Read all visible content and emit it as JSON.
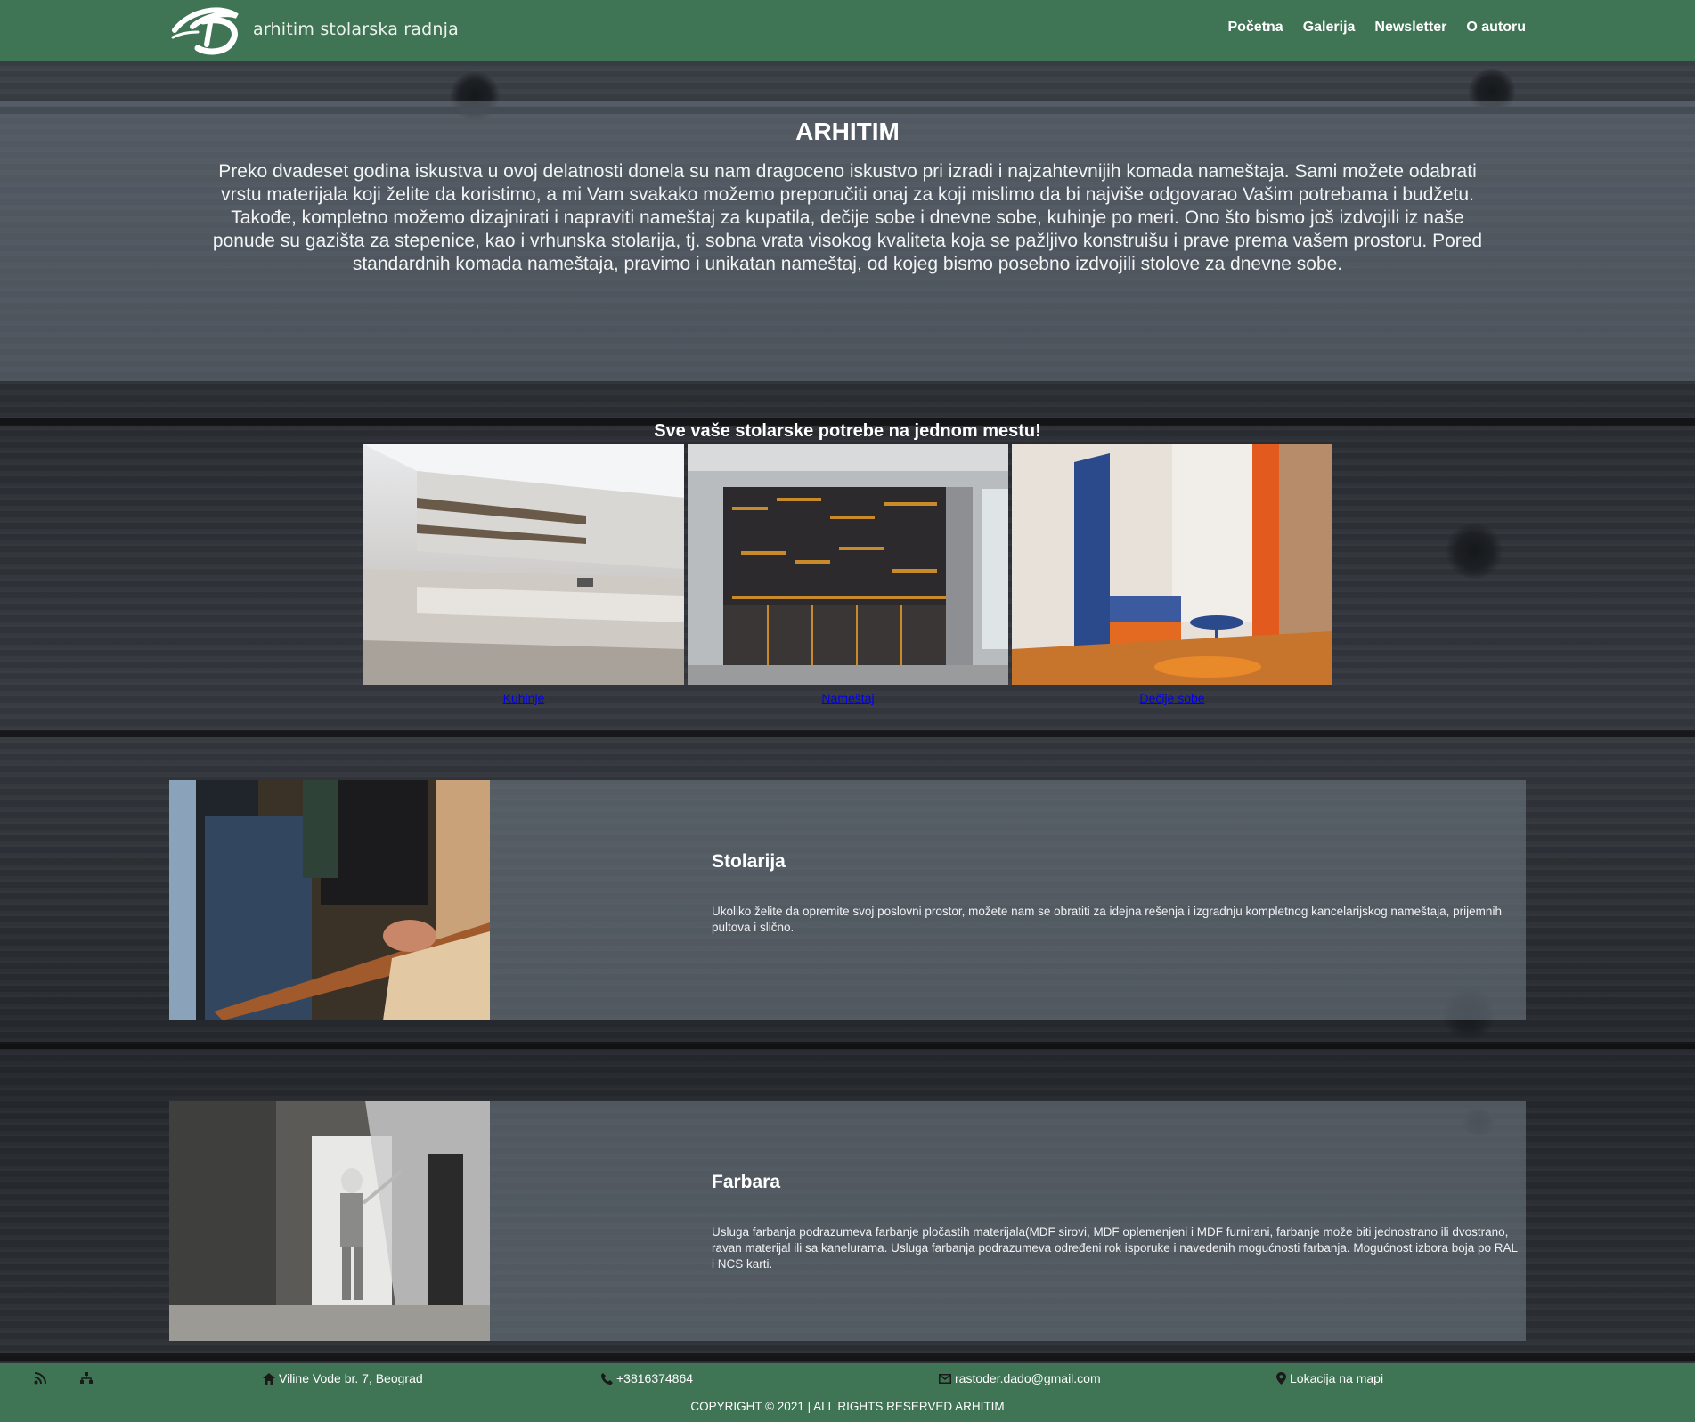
{
  "header": {
    "brand_name": "arhitim stolarska radnja",
    "nav": [
      "Početna",
      "Galerija",
      "Newsletter",
      "O autoru"
    ]
  },
  "hero": {
    "title": "ARHITIM",
    "text": "Preko dvadeset godina iskustva u ovoj delatnosti donela su nam dragoceno iskustvo pri izradi i najzahtevnijih komada nameštaja. Sami možete odabrati vrstu materijala koji želite da koristimo, a mi Vam svakako možemo preporučiti onaj za koji mislimo da bi najviše odgovarao Vašim potrebama i budžetu. Takođe, kompletno možemo dizajnirati i napraviti nameštaj za kupatila, dečije sobe i dnevne sobe, kuhinje po meri. Ono što bismo još izdvojili iz naše ponude su gazišta za stepenice, kao i vrhunska stolarija, tj. sobna vrata visokog kvaliteta koja se pažljivo konstruišu i prave prema vašem prostoru. Pored standardnih komada nameštaja, pravimo i unikatan nameštaj, od kojeg bismo posebno izdvojili stolove za dnevne sobe."
  },
  "categories": {
    "heading": "Sve vaše stolarske potrebe na jednom mestu!",
    "items": [
      {
        "label": "Kuhinje"
      },
      {
        "label": "Nameštaj"
      },
      {
        "label": "Dečije sobe"
      }
    ]
  },
  "services": [
    {
      "title": "Stolarija",
      "text": "Ukoliko želite da opremite svoj poslovni prostor, možete nam se obratiti za idejna rešenja i izgradnju kompletnog kancelarijskog nameštaja, prijemnih pultova i slično."
    },
    {
      "title": "Farbara",
      "text": "Usluga farbanja podrazumeva farbanje pločastih materijala(MDF sirovi, MDF oplemenjeni i MDF furnirani, farbanje može biti jednostrano ili dvostrano, ravan materijal ili sa kanelurama. Usluga farbanja podrazumeva određeni rok isporuke i navedenih mogućnosti farbanja. Mogućnost izbora boja po RAL i NCS karti."
    }
  ],
  "footer": {
    "address": "Viline Vode br. 7, Beograd",
    "phone": "+3816374864",
    "email": "rastoder.dado@gmail.com",
    "map_link": "Lokacija na mapi",
    "copyright": "COPYRIGHT © 2021 | ALL RIGHTS RESERVED ARHITIM",
    "icons": [
      "rss-icon",
      "sitemap-icon",
      "home-icon",
      "phone-icon",
      "mail-icon",
      "map-pin-icon"
    ]
  },
  "colors": {
    "header_green": "#3f7455",
    "panel_overlay": "#6c7680",
    "text": "#ffffff"
  }
}
